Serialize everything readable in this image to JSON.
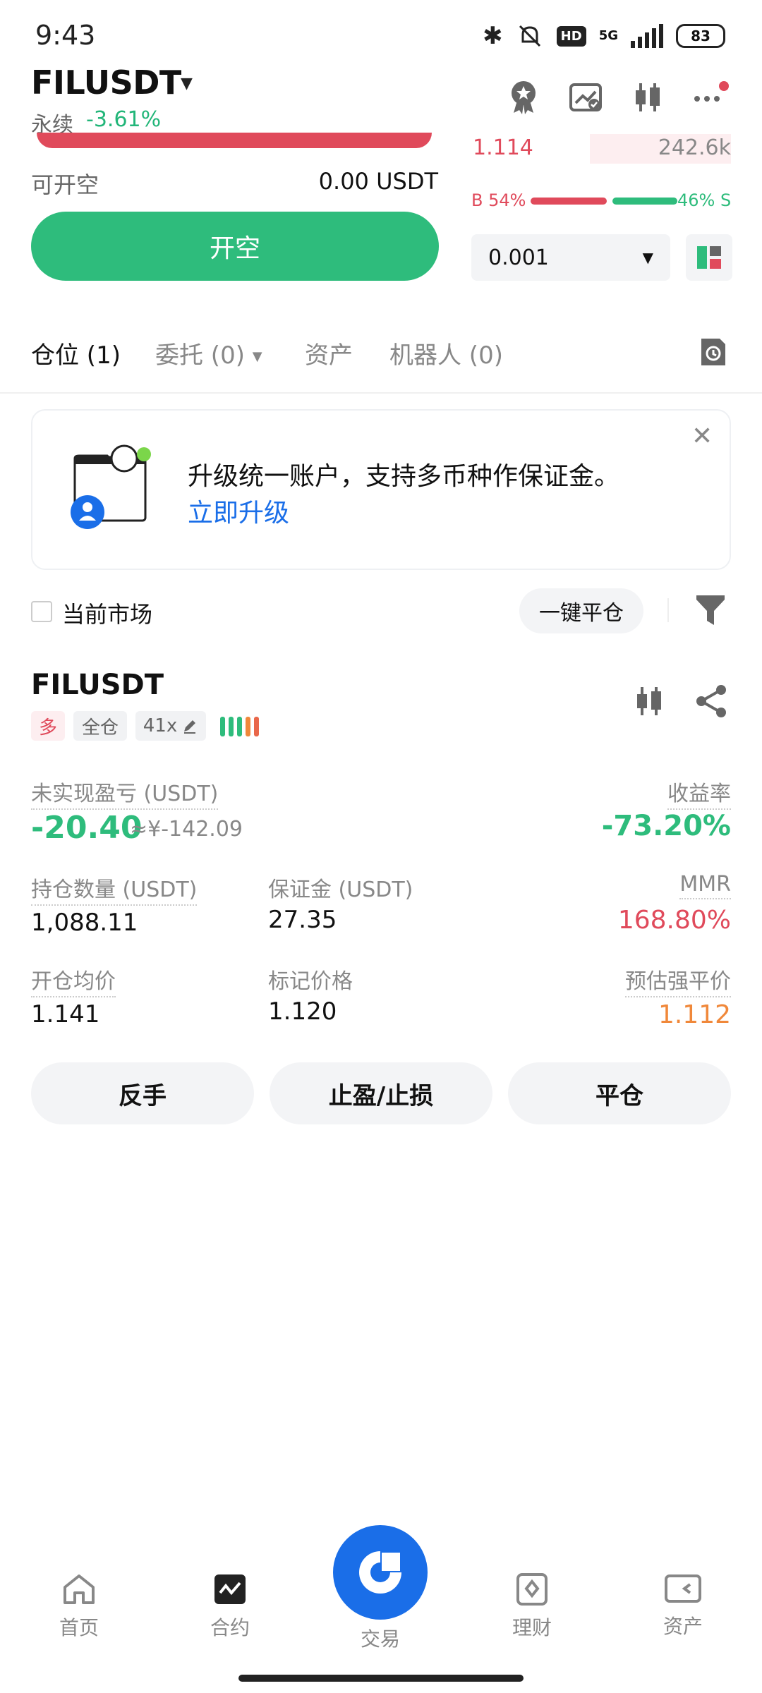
{
  "status_bar": {
    "time": "9:43",
    "network": "5G",
    "battery": "83",
    "hd": "HD"
  },
  "header": {
    "symbol": "FILUSDT",
    "market_type": "永续",
    "change": "-3.61%"
  },
  "orderbook": {
    "price": "1.114",
    "volume": "242.6k",
    "buy_ratio": "B 54%",
    "sell_ratio": "46% S",
    "buy_ratio_value": 0.54,
    "depth": "0.001"
  },
  "order_form": {
    "available_label": "可开空",
    "available_value": "0.00 USDT",
    "open_short_label": "开空"
  },
  "tabs": [
    {
      "label": "仓位 (1)"
    },
    {
      "label": "委托 (0)"
    },
    {
      "label": "资产"
    },
    {
      "label": "机器人 (0)"
    }
  ],
  "banner": {
    "text": "升级统一账户，支持多币种作保证金。",
    "link": "立即升级"
  },
  "filter": {
    "current_market_label": "当前市场",
    "close_all_label": "一键平仓"
  },
  "position": {
    "symbol": "FILUSDT",
    "side_tag": "多",
    "margin_mode_tag": "全仓",
    "leverage_tag": "41x",
    "pnl_label": "未实现盈亏 (USDT)",
    "pnl_value": "-20.40",
    "pnl_cny": "≈¥-142.09",
    "roe_label": "收益率",
    "roe_value": "-73.20%",
    "qty_label": "持仓数量 (USDT)",
    "qty_value": "1,088.11",
    "margin_label": "保证金 (USDT)",
    "margin_value": "27.35",
    "mmr_label": "MMR",
    "mmr_value": "168.80%",
    "entry_label": "开仓均价",
    "entry_value": "1.141",
    "mark_label": "标记价格",
    "mark_value": "1.120",
    "liq_label": "预估强平价",
    "liq_value": "1.112",
    "actions": {
      "reverse": "反手",
      "tpsl": "止盈/止损",
      "close": "平仓"
    }
  },
  "bottom_nav": [
    {
      "label": "首页",
      "icon": "home-icon"
    },
    {
      "label": "合约",
      "icon": "futures-icon"
    },
    {
      "label": "交易",
      "icon": "trade-icon"
    },
    {
      "label": "理财",
      "icon": "earn-icon"
    },
    {
      "label": "资产",
      "icon": "wallet-icon"
    }
  ],
  "colors": {
    "green": "#2ebc7c",
    "red": "#e04a5b",
    "blue": "#1a6ee8",
    "orange": "#f0883a"
  }
}
